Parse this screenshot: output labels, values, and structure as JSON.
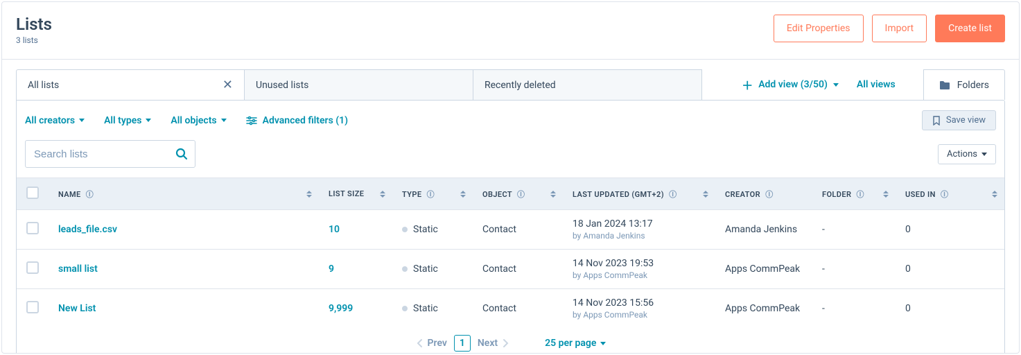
{
  "header": {
    "title": "Lists",
    "subtitle": "3 lists",
    "edit_properties": "Edit Properties",
    "import": "Import",
    "create_list": "Create list"
  },
  "tabs": {
    "all_lists": "All lists",
    "unused_lists": "Unused lists",
    "recently_deleted": "Recently deleted",
    "add_view": "Add view (3/50)",
    "all_views": "All views",
    "folders": "Folders"
  },
  "filters": {
    "creators": "All creators",
    "types": "All types",
    "objects": "All objects",
    "advanced": "Advanced filters (1)",
    "save_view": "Save view"
  },
  "search": {
    "placeholder": "Search lists",
    "actions": "Actions"
  },
  "columns": {
    "name": "NAME",
    "size": "LIST SIZE",
    "type": "TYPE",
    "object": "OBJECT",
    "updated": "LAST UPDATED (GMT+2)",
    "creator": "CREATOR",
    "folder": "FOLDER",
    "used_in": "USED IN"
  },
  "rows": [
    {
      "name": "leads_file.csv",
      "size": "10",
      "type": "Static",
      "object": "Contact",
      "updated_at": "18 Jan 2024 13:17",
      "updated_by": "by Amanda Jenkins",
      "creator": "Amanda Jenkins",
      "folder": "-",
      "used_in": "0"
    },
    {
      "name": "small list",
      "size": "9",
      "type": "Static",
      "object": "Contact",
      "updated_at": "14 Nov 2023 19:53",
      "updated_by": "by Apps CommPeak",
      "creator": "Apps CommPeak",
      "folder": "-",
      "used_in": "0"
    },
    {
      "name": "New List",
      "size": "9,999",
      "type": "Static",
      "object": "Contact",
      "updated_at": "14 Nov 2023 15:56",
      "updated_by": "by Apps CommPeak",
      "creator": "Apps CommPeak",
      "folder": "-",
      "used_in": "0"
    }
  ],
  "pager": {
    "prev": "Prev",
    "page": "1",
    "next": "Next",
    "per_page": "25 per page"
  }
}
